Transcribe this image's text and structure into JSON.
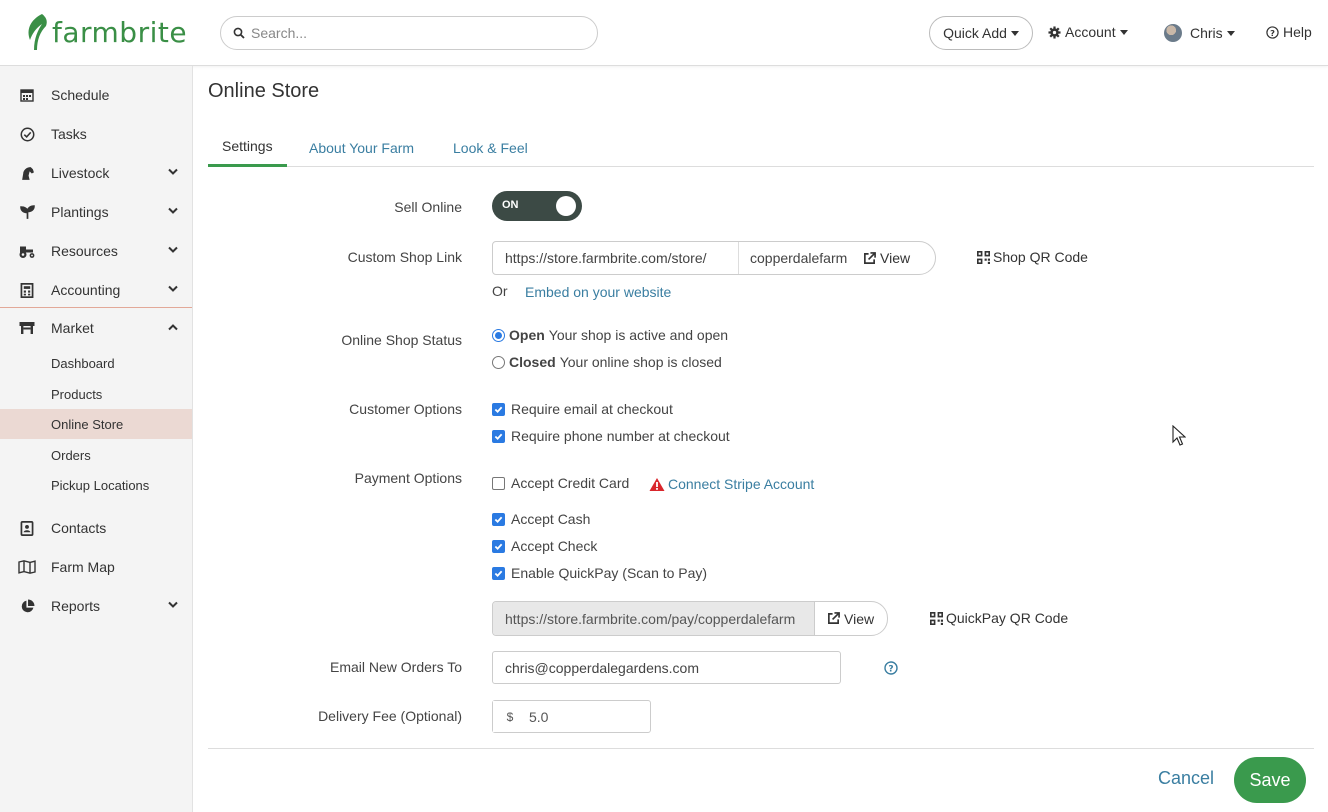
{
  "header": {
    "logo_text": "farmbrite",
    "search_placeholder": "Search...",
    "quick_add": "Quick Add",
    "account": "Account",
    "user": "Chris",
    "help": "Help"
  },
  "sidebar": {
    "items": [
      {
        "label": "Schedule",
        "icon": "calendar-icon"
      },
      {
        "label": "Tasks",
        "icon": "check-circle-icon"
      },
      {
        "label": "Livestock",
        "icon": "horse-icon"
      },
      {
        "label": "Plantings",
        "icon": "seedling-icon"
      },
      {
        "label": "Resources",
        "icon": "tractor-icon"
      },
      {
        "label": "Accounting",
        "icon": "calculator-icon"
      },
      {
        "label": "Market",
        "icon": "store-icon"
      },
      {
        "label": "Contacts",
        "icon": "address-book-icon"
      },
      {
        "label": "Farm Map",
        "icon": "map-icon"
      },
      {
        "label": "Reports",
        "icon": "pie-chart-icon"
      }
    ],
    "market_sub": [
      "Dashboard",
      "Products",
      "Online Store",
      "Orders",
      "Pickup Locations"
    ]
  },
  "page": {
    "title": "Online Store",
    "tabs": [
      "Settings",
      "About Your Farm",
      "Look & Feel"
    ]
  },
  "form": {
    "sell_online_label": "Sell Online",
    "toggle_state": "ON",
    "custom_link_label": "Custom Shop Link",
    "link_prefix": "https://store.farmbrite.com/store/",
    "link_slug": "copperdalefarm",
    "view": "View",
    "shop_qr": "Shop QR Code",
    "or": "Or",
    "embed_link": "Embed on your website",
    "status_label": "Online Shop Status",
    "status_open_bold": "Open",
    "status_open_text": "Your shop is active and open",
    "status_closed_bold": "Closed",
    "status_closed_text": "Your online shop is closed",
    "customer_label": "Customer Options",
    "require_email": "Require email at checkout",
    "require_phone": "Require phone number at checkout",
    "payment_label": "Payment Options",
    "accept_credit": "Accept Credit Card",
    "connect_stripe": "Connect Stripe Account",
    "accept_cash": "Accept Cash",
    "accept_check": "Accept Check",
    "quickpay": "Enable QuickPay (Scan to Pay)",
    "pay_url": "https://store.farmbrite.com/pay/copperdalefarm",
    "quickpay_qr": "QuickPay QR Code",
    "email_label": "Email New Orders To",
    "email_value": "chris@copperdalegardens.com",
    "fee_label": "Delivery Fee (Optional)",
    "fee_currency": "$",
    "fee_value": "5.0",
    "cancel": "Cancel",
    "save": "Save"
  },
  "colors": {
    "brand_green": "#3a9a4d",
    "link_blue": "#3a7ea1",
    "checkbox_blue": "#2a7ae2",
    "warning_red": "#d9262c"
  }
}
